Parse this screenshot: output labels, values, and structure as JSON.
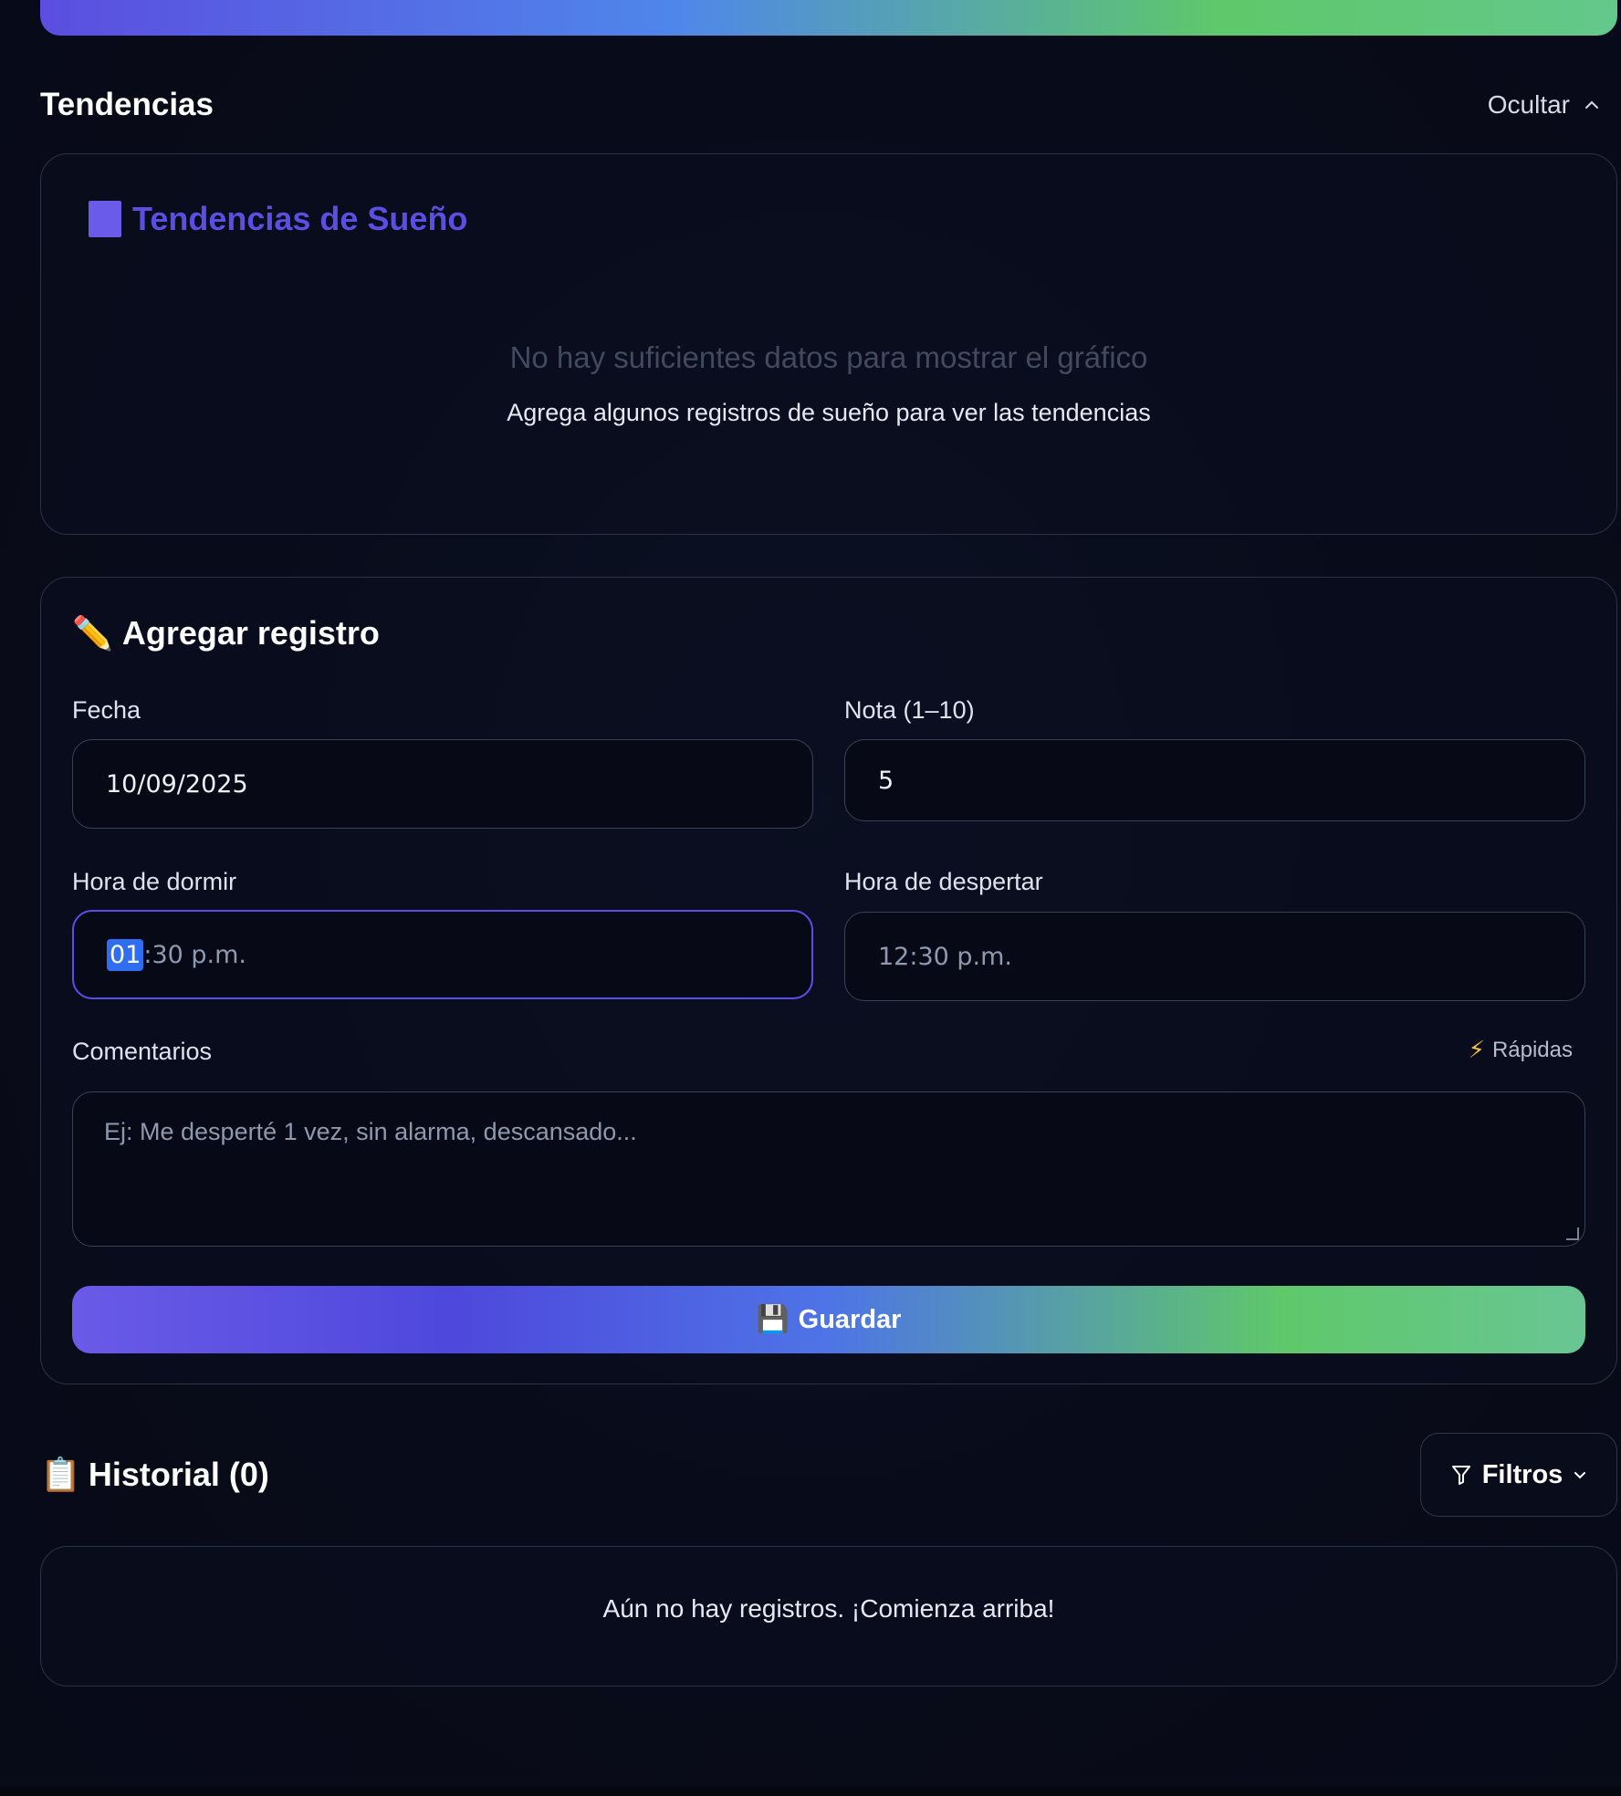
{
  "trends_section": {
    "title": "Tendencias",
    "hide_label": "Ocultar",
    "chart_card": {
      "title": "Tendencias de Sueño",
      "empty_message": "No hay suficientes datos para mostrar el gráfico",
      "empty_hint": "Agrega algunos registros de sueño para ver las tendencias"
    }
  },
  "form": {
    "title": "Agregar registro",
    "title_emoji": "✏️",
    "date_label": "Fecha",
    "date_value": "10/09/2025",
    "rating_label": "Nota (1–10)",
    "rating_value": "5",
    "sleep_label": "Hora de dormir",
    "sleep_hour": "01",
    "sleep_rest": ":30 p.m.",
    "wake_label": "Hora de despertar",
    "wake_value": "12:30 p.m.",
    "comments_label": "Comentarios",
    "quick_label": "Rápidas",
    "comments_placeholder": "Ej: Me desperté 1 vez, sin alarma, descansado...",
    "save_emoji": "💾",
    "save_label": "Guardar"
  },
  "history": {
    "emoji": "📋",
    "title": "Historial (0)",
    "filters_label": "Filtros",
    "empty_message": "Aún no hay registros. ¡Comienza arriba!"
  },
  "colors": {
    "accent": "#5a4fe0",
    "gradient_start": "#6a5ae8",
    "gradient_mid": "#4e74e6",
    "gradient_end": "#5fc86a",
    "background": "#0a0e1f"
  }
}
